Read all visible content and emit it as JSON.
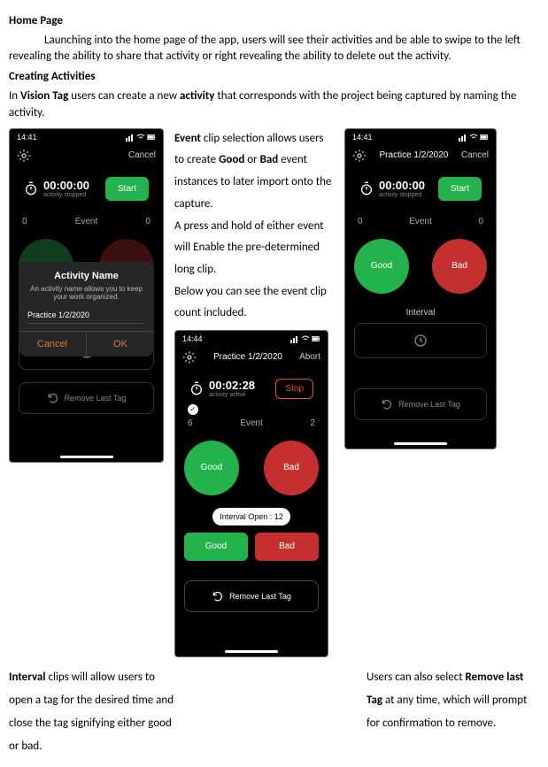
{
  "doc": {
    "h1": "Home Page",
    "p1": "Launching into the home page of the app, users will see their activities and be able to swipe to the left revealing the ability to share that activity or right revealing the ability to delete out the activity.",
    "h2": "Creating Activities",
    "p2a": " In ",
    "p2b": "Vision Tag",
    "p2c": " users can create a new ",
    "p2d": "activity",
    "p2e": " that corresponds with the project being captured by naming the activity.",
    "mid1a": "Event",
    "mid1b": " clip selection allows users to create ",
    "mid1c": "Good",
    "mid1d": " or ",
    "mid1e": "Bad",
    "mid1f": " event instances to later import onto the capture.",
    "mid2": "A press and hold of either event will Enable the pre-determined long clip.",
    "mid3": "Below you can see the event clip count included.",
    "bl1a": "Interval",
    "bl1b": " clips will allow users to open a tag for the desired time and close the tag signifying either good or bad.",
    "br1": "Users can also select ",
    "br2": "Remove last Tag",
    "br3": " at any time, which will prompt for confirmation to remove."
  },
  "common": {
    "time": "14:41",
    "time2": "14:44",
    "cancel": "Cancel",
    "abort": "Abort",
    "event": "Event",
    "interval": "Interval",
    "good": "Good",
    "bad": "Bad",
    "remove": "Remove Last Tag",
    "zero": "0"
  },
  "phoneA": {
    "timer": "00:00:00",
    "status": "activity stopped",
    "start": "Start",
    "left": "0",
    "right": "0",
    "modal_title": "Activity Name",
    "modal_sub": "An activity name allows you to keep your work organized.",
    "modal_input": "Practice 1/2/2020",
    "modal_cancel": "Cancel",
    "modal_ok": "OK"
  },
  "phoneB": {
    "title": "Practice 1/2/2020",
    "timer": "00:00:00",
    "status": "activity stopped",
    "start": "Start",
    "left": "0",
    "right": "0"
  },
  "phoneC": {
    "title": "Practice 1/2/2020",
    "timer": "00:02:28",
    "status": "activity active",
    "stop": "Stop",
    "checkcount": "6",
    "eventcount": "2",
    "intervalopen": "Interval Open : 12"
  }
}
